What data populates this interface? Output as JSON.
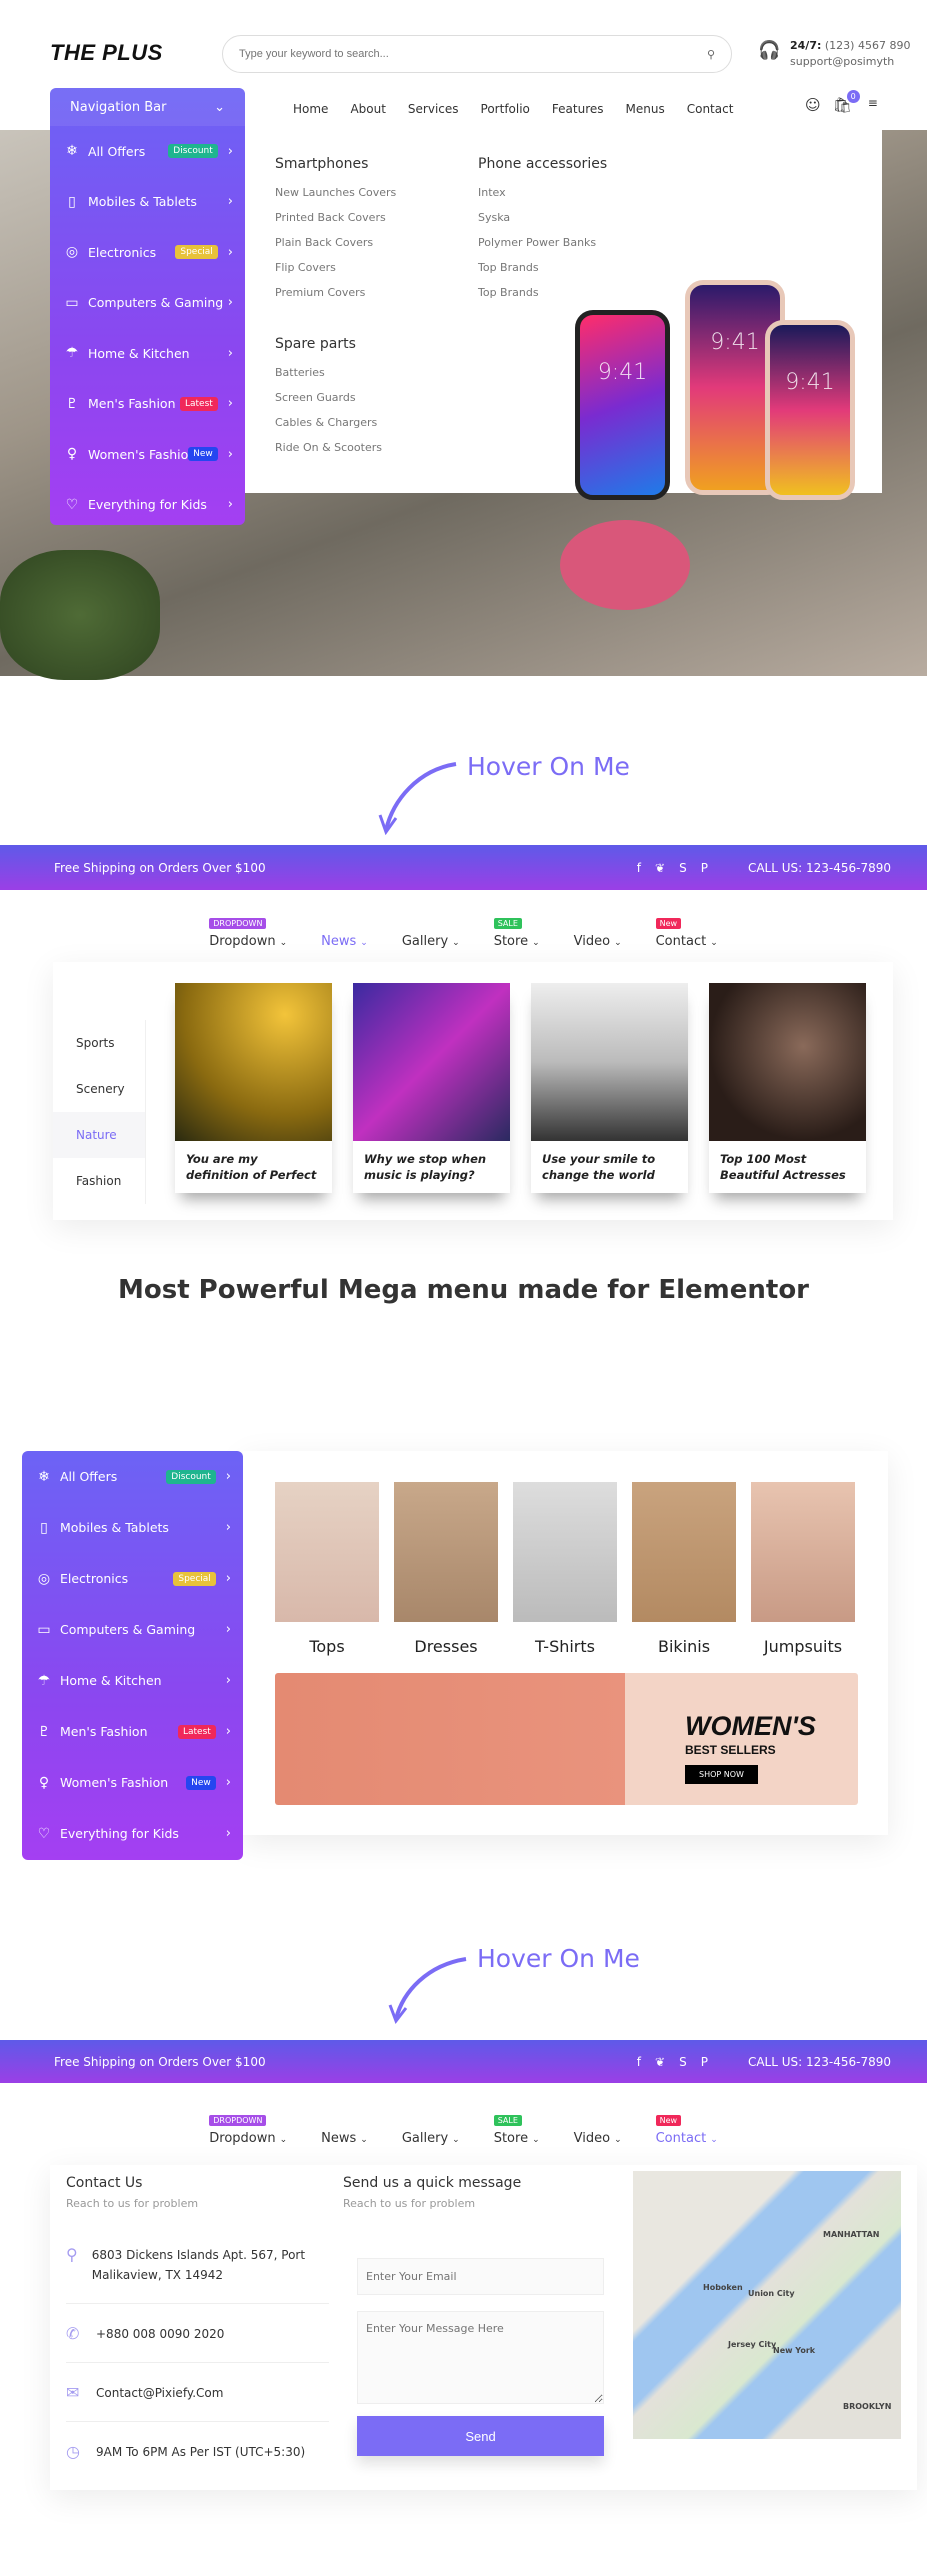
{
  "header": {
    "logo": "THE PLUS",
    "search_placeholder": "Type your keyword to search...",
    "hours_label": "24/7:",
    "phone": "(123) 4567 890",
    "email": "support@posimyth",
    "cart_count": "0"
  },
  "top_nav": [
    "Home",
    "About",
    "Services",
    "Portfolio",
    "Features",
    "Menus",
    "Contact"
  ],
  "nav_panel": {
    "title": "Navigation Bar",
    "items": [
      {
        "label": "All Offers",
        "icon": "snowflake-icon",
        "badge": "Discount",
        "badge_color": "#1fb58f"
      },
      {
        "label": "Mobiles & Tablets",
        "icon": "mobile-icon",
        "badge": "",
        "badge_color": ""
      },
      {
        "label": "Electronics",
        "icon": "camera-icon",
        "badge": "Special",
        "badge_color": "#e8c23a"
      },
      {
        "label": "Computers & Gaming",
        "icon": "laptop-icon",
        "badge": "",
        "badge_color": ""
      },
      {
        "label": "Home & Kitchen",
        "icon": "chef-hat-icon",
        "badge": "",
        "badge_color": ""
      },
      {
        "label": "Men's Fashion",
        "icon": "jacket-icon",
        "badge": "Latest",
        "badge_color": "#f0285a"
      },
      {
        "label": "Women's Fashion",
        "icon": "dress-icon",
        "badge": "New",
        "badge_color": "#2546f0"
      },
      {
        "label": "Everything for Kids",
        "icon": "onesie-icon",
        "badge": "",
        "badge_color": ""
      }
    ]
  },
  "mega": {
    "col1": {
      "title": "Smartphones",
      "links": [
        "New Launches Covers",
        "Printed Back Covers",
        "Plain Back Covers",
        "Flip Covers",
        "Premium Covers"
      ]
    },
    "col2": {
      "title": "Phone accessories",
      "links": [
        "Intex",
        "Syska",
        "Polymer Power Banks",
        "Top Brands",
        "Top Brands"
      ]
    },
    "col3": {
      "title": "Spare parts",
      "links": [
        "Batteries",
        "Screen Guards",
        "Cables & Chargers",
        "Ride On & Scooters"
      ]
    },
    "phone_time": "9:41"
  },
  "hover_label": "Hover On Me",
  "topbar": {
    "shipping": "Free Shipping on Orders Over $100",
    "call": "CALL US: 123-456-7890",
    "social": [
      "facebook-icon",
      "twitter-icon",
      "skype-icon",
      "pinterest-icon"
    ]
  },
  "nav2": [
    {
      "label": "Dropdown",
      "tag": "DROPDOWN",
      "tag_color": "#a64ee8"
    },
    {
      "label": "News",
      "tag": "",
      "tag_color": ""
    },
    {
      "label": "Gallery",
      "tag": "",
      "tag_color": ""
    },
    {
      "label": "Store",
      "tag": "SALE",
      "tag_color": "#2fc25b"
    },
    {
      "label": "Video",
      "tag": "",
      "tag_color": ""
    },
    {
      "label": "Contact",
      "tag": "New",
      "tag_color": "#f0285a"
    }
  ],
  "news": {
    "tabs": [
      "Sports",
      "Scenery",
      "Nature",
      "Fashion"
    ],
    "active_tab": "Nature",
    "cards": [
      "You are my definition of Perfect",
      "Why we stop when music is playing?",
      "Use your smile to change the world",
      "Top 100 Most Beautiful Actresses"
    ]
  },
  "headline": "Most Powerful Mega menu made for Elementor",
  "fashion": {
    "products": [
      "Tops",
      "Dresses",
      "T-Shirts",
      "Bikinis",
      "Jumpsuits"
    ],
    "banner_title": "WOMEN'S",
    "banner_sub": "BEST SELLERS",
    "banner_button": "SHOP NOW"
  },
  "contact": {
    "title": "Contact Us",
    "subtitle": "Reach to us for problem",
    "address": "6803 Dickens Islands Apt. 567, Port Malikaview, TX 14942",
    "phone": "+880 008 0090 2020",
    "email": "Contact@Pixiefy.Com",
    "hours": "9AM To 6PM As Per IST (UTC+5:30)",
    "form_title": "Send us a quick message",
    "form_subtitle": "Reach to us for problem",
    "email_placeholder": "Enter Your Email",
    "message_placeholder": "Enter Your Message Here",
    "send_label": "Send"
  },
  "map_labels": [
    "MANHATTAN",
    "New York",
    "Jersey City",
    "Hoboken",
    "Union City",
    "BROOKLYN"
  ],
  "colors": {
    "accent": "#7b6cf5",
    "gradient_start": "#6c63f5",
    "gradient_end": "#a43ff2"
  }
}
